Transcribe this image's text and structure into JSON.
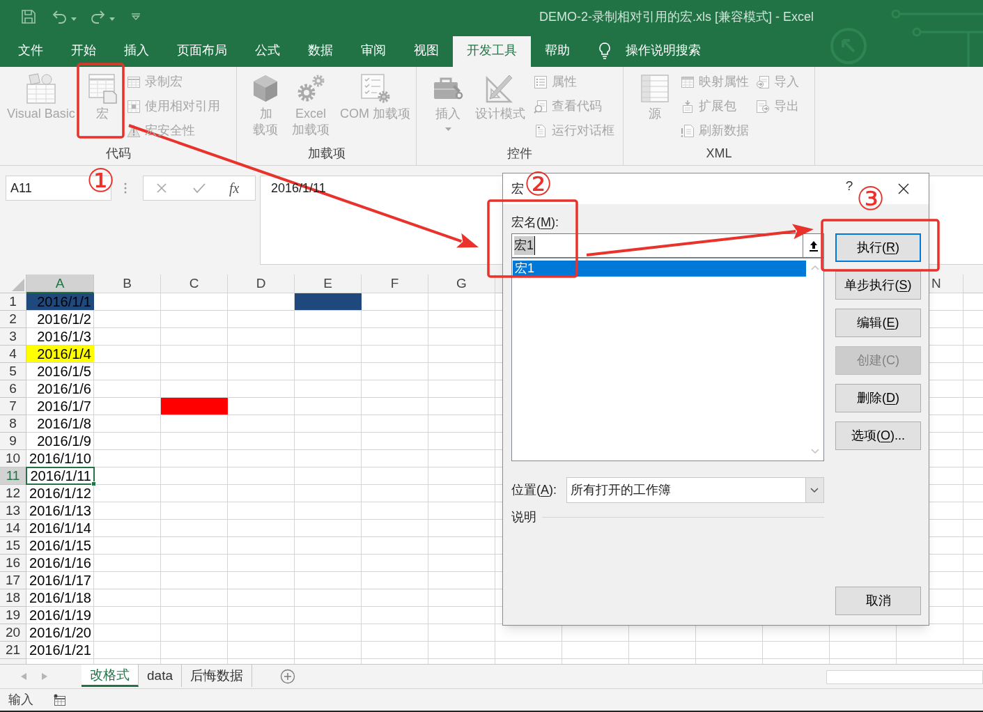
{
  "title_bar": {
    "title": "DEMO-2-录制相对引用的宏.xls [兼容模式] - Excel"
  },
  "tabs": [
    {
      "label": "文件",
      "selected": false
    },
    {
      "label": "开始",
      "selected": false
    },
    {
      "label": "插入",
      "selected": false
    },
    {
      "label": "页面布局",
      "selected": false
    },
    {
      "label": "公式",
      "selected": false
    },
    {
      "label": "数据",
      "selected": false
    },
    {
      "label": "审阅",
      "selected": false
    },
    {
      "label": "视图",
      "selected": false
    },
    {
      "label": "开发工具",
      "selected": true
    },
    {
      "label": "帮助",
      "selected": false
    }
  ],
  "tell_me": {
    "label": "操作说明搜索"
  },
  "ribbon": {
    "groups": [
      {
        "label": "代码",
        "items": [
          {
            "kind": "large",
            "label": "Visual Basic",
            "disabled": true
          },
          {
            "kind": "large",
            "label": "宏",
            "disabled": true
          },
          {
            "kind": "small",
            "label": "录制宏",
            "disabled": true
          },
          {
            "kind": "small",
            "label": "使用相对引用",
            "disabled": true
          },
          {
            "kind": "small",
            "label": "宏安全性",
            "disabled": true
          }
        ]
      },
      {
        "label": "加载项",
        "items": [
          {
            "kind": "large",
            "label": "加载项",
            "disabled": true
          },
          {
            "kind": "large",
            "label": "Excel 加载项",
            "disabled": true
          },
          {
            "kind": "large",
            "label": "COM 加载项",
            "disabled": true
          }
        ]
      },
      {
        "label": "控件",
        "items": [
          {
            "kind": "dropdown",
            "label": "插入",
            "disabled": true
          },
          {
            "kind": "large",
            "label": "设计模式",
            "disabled": true
          },
          {
            "kind": "small",
            "label": "属性",
            "disabled": true
          },
          {
            "kind": "small",
            "label": "查看代码",
            "disabled": true
          },
          {
            "kind": "small",
            "label": "运行对话框",
            "disabled": true
          }
        ]
      },
      {
        "label": "XML",
        "items": [
          {
            "kind": "large",
            "label": "源",
            "disabled": true
          },
          {
            "kind": "small",
            "label": "映射属性",
            "disabled": true
          },
          {
            "kind": "small",
            "label": "扩展包",
            "disabled": true
          },
          {
            "kind": "small",
            "label": "刷新数据",
            "disabled": true
          },
          {
            "kind": "small",
            "label": "导入",
            "disabled": true
          },
          {
            "kind": "small",
            "label": "导出",
            "disabled": true
          }
        ]
      }
    ]
  },
  "formula_bar": {
    "name_box": "A11",
    "function_label": "fx",
    "formula": "2016/1/11"
  },
  "sheet": {
    "columns": [
      {
        "label": "A",
        "selected": true
      },
      {
        "label": "B",
        "selected": false
      },
      {
        "label": "C",
        "selected": false
      },
      {
        "label": "D",
        "selected": false
      },
      {
        "label": "E",
        "selected": false
      },
      {
        "label": "F",
        "selected": false
      },
      {
        "label": "G",
        "selected": false
      }
    ],
    "columns_beyond_dialog": [
      {
        "label": "N",
        "selected": false
      }
    ],
    "rows": [
      {
        "label": "1",
        "selected": false,
        "cells": [
          {
            "value": "2016/1/1",
            "selected": false,
            "color": "#1f497d"
          },
          {
            "selected": false
          },
          {
            "selected": false
          },
          {
            "selected": false
          },
          {
            "selected": false,
            "color": "#1f497d"
          }
        ]
      },
      {
        "label": "2",
        "selected": false,
        "cells": [
          {
            "value": "2016/1/2",
            "selected": false
          }
        ]
      },
      {
        "label": "3",
        "selected": false,
        "cells": [
          {
            "value": "2016/1/3",
            "selected": false
          }
        ]
      },
      {
        "label": "4",
        "selected": false,
        "cells": [
          {
            "value": "2016/1/4",
            "selected": false,
            "color": "#ffff00"
          }
        ]
      },
      {
        "label": "5",
        "selected": false,
        "cells": [
          {
            "value": "2016/1/5",
            "selected": false
          }
        ]
      },
      {
        "label": "6",
        "selected": false,
        "cells": [
          {
            "value": "2016/1/6",
            "selected": false
          }
        ]
      },
      {
        "label": "7",
        "selected": false,
        "cells": [
          {
            "value": "2016/1/7",
            "selected": false
          },
          {
            "selected": false
          },
          {
            "selected": false,
            "color": "#ff0000"
          }
        ]
      },
      {
        "label": "8",
        "selected": false,
        "cells": [
          {
            "value": "2016/1/8",
            "selected": false
          }
        ]
      },
      {
        "label": "9",
        "selected": false,
        "cells": [
          {
            "value": "2016/1/9",
            "selected": false
          }
        ]
      },
      {
        "label": "10",
        "selected": false,
        "cells": [
          {
            "value": "2016/1/10",
            "selected": false
          }
        ]
      },
      {
        "label": "11",
        "selected": true,
        "cells": [
          {
            "value": "2016/1/11",
            "selected": true
          }
        ]
      },
      {
        "label": "12",
        "selected": false,
        "cells": [
          {
            "value": "2016/1/12",
            "selected": false
          }
        ]
      },
      {
        "label": "13",
        "selected": false,
        "cells": [
          {
            "value": "2016/1/13",
            "selected": false
          }
        ]
      },
      {
        "label": "14",
        "selected": false,
        "cells": [
          {
            "value": "2016/1/14",
            "selected": false
          }
        ]
      },
      {
        "label": "15",
        "selected": false,
        "cells": [
          {
            "value": "2016/1/15",
            "selected": false
          }
        ]
      },
      {
        "label": "16",
        "selected": false,
        "cells": [
          {
            "value": "2016/1/16",
            "selected": false
          }
        ]
      },
      {
        "label": "17",
        "selected": false,
        "cells": [
          {
            "value": "2016/1/17",
            "selected": false
          }
        ]
      },
      {
        "label": "18",
        "selected": false,
        "cells": [
          {
            "value": "2016/1/18",
            "selected": false
          }
        ]
      },
      {
        "label": "19",
        "selected": false,
        "cells": [
          {
            "value": "2016/1/19",
            "selected": false
          }
        ]
      },
      {
        "label": "20",
        "selected": false,
        "cells": [
          {
            "value": "2016/1/20",
            "selected": false
          }
        ]
      },
      {
        "label": "21",
        "selected": false,
        "cells": [
          {
            "value": "2016/1/21",
            "selected": false
          }
        ]
      }
    ]
  },
  "sheet_tabs": [
    {
      "label": "改格式",
      "selected": true
    },
    {
      "label": "data",
      "selected": false
    },
    {
      "label": "后悔数据",
      "selected": false
    }
  ],
  "status_bar": {
    "mode": "输入"
  },
  "dialog": {
    "title": "宏",
    "help": "?",
    "name_label": "宏名(M):",
    "name_value": "宏1",
    "name_value_selected": true,
    "macros": [
      {
        "name": "宏1",
        "selected": true
      }
    ],
    "buttons": [
      {
        "label": "执行(R)",
        "default": true,
        "disabled": false
      },
      {
        "label": "单步执行(S)",
        "default": false,
        "disabled": false
      },
      {
        "label": "编辑(E)",
        "default": false,
        "disabled": false
      },
      {
        "label": "创建(C)",
        "default": false,
        "disabled": true
      },
      {
        "label": "删除(D)",
        "default": false,
        "disabled": false
      },
      {
        "label": "选项(O)...",
        "default": false,
        "disabled": false
      },
      {
        "label": "取消",
        "default": false,
        "disabled": false
      }
    ],
    "location_label": "位置(A):",
    "location_value": "所有打开的工作簿",
    "description_label": "说明"
  },
  "annotations": {
    "steps": [
      {
        "number": "①"
      },
      {
        "number": "②"
      },
      {
        "number": "③"
      }
    ]
  }
}
